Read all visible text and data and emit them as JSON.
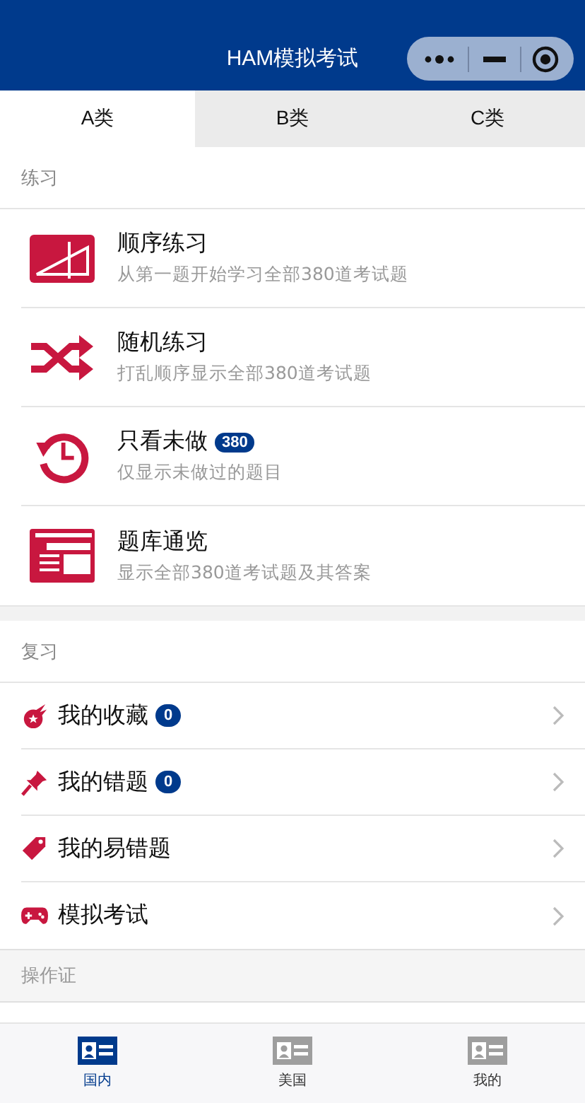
{
  "header": {
    "title": "HAM模拟考试"
  },
  "tabs": [
    {
      "label": "A类",
      "selected": true
    },
    {
      "label": "B类",
      "selected": false
    },
    {
      "label": "C类",
      "selected": false
    }
  ],
  "practice": {
    "heading": "练习",
    "items": [
      {
        "title": "顺序练习",
        "subtitle": "从第一题开始学习全部380道考试题"
      },
      {
        "title": "随机练习",
        "subtitle": "打乱顺序显示全部380道考试题"
      },
      {
        "title": "只看未做",
        "badge": "380",
        "subtitle": "仅显示未做过的题目"
      },
      {
        "title": "题库通览",
        "subtitle": "显示全部380道考试题及其答案"
      }
    ]
  },
  "review": {
    "heading": "复习",
    "items": [
      {
        "title": "我的收藏",
        "badge": "0"
      },
      {
        "title": "我的错题",
        "badge": "0"
      },
      {
        "title": "我的易错题"
      },
      {
        "title": "模拟考试"
      }
    ]
  },
  "license": {
    "heading": "操作证"
  },
  "bottom_nav": [
    {
      "label": "国内",
      "selected": true
    },
    {
      "label": "美国",
      "selected": false
    },
    {
      "label": "我的",
      "selected": false
    }
  ]
}
